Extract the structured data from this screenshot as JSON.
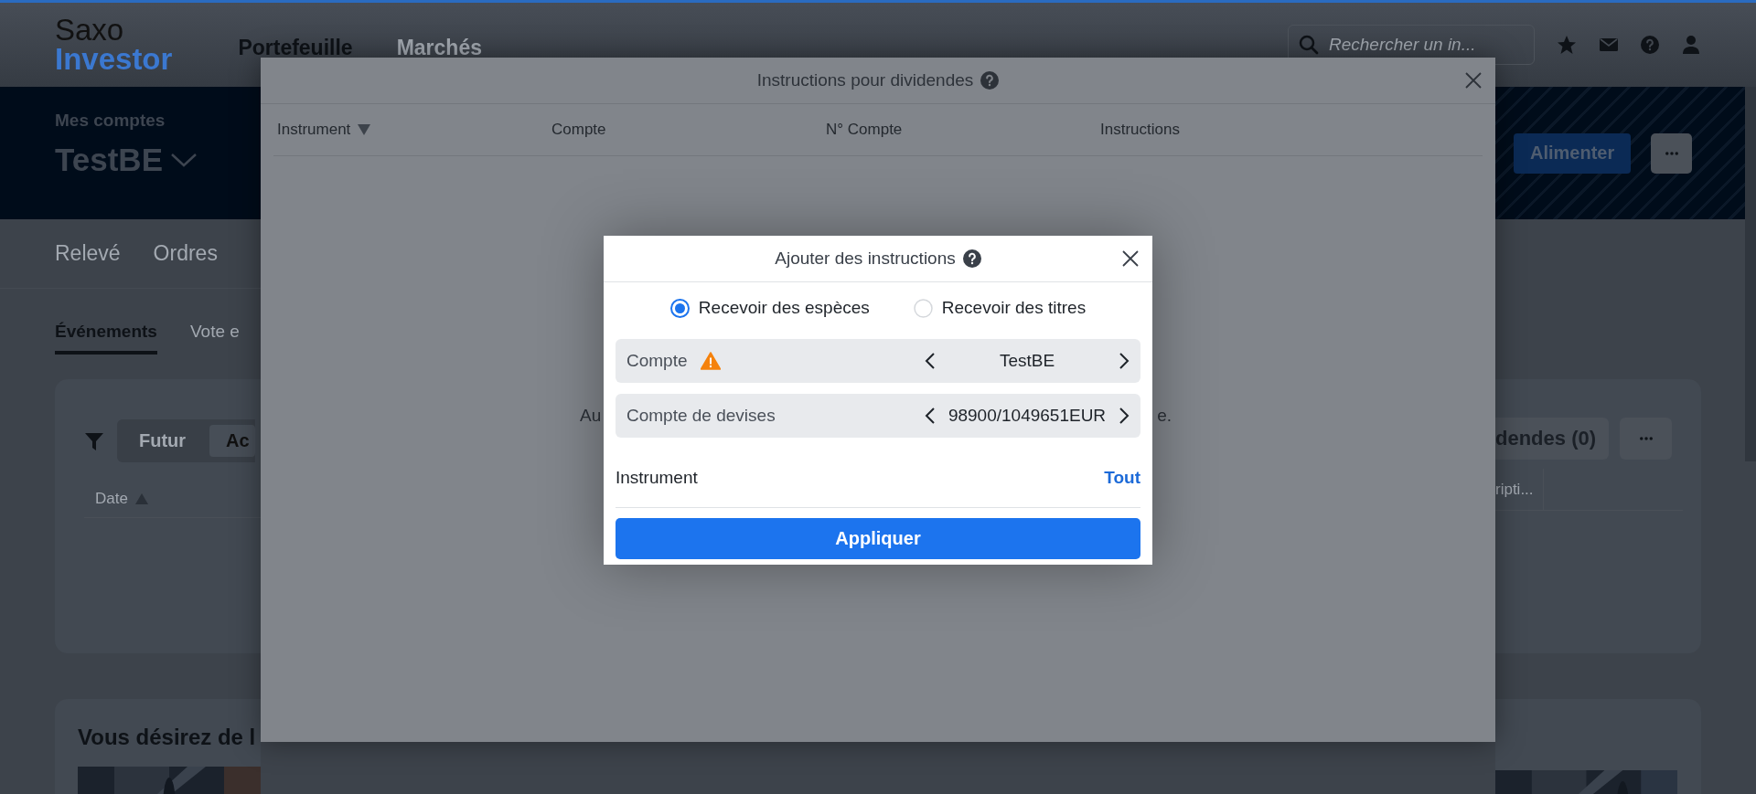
{
  "header": {
    "logo_top": "Saxo",
    "logo_bottom": "Investor",
    "nav": [
      {
        "label": "Portefeuille",
        "selected": true
      },
      {
        "label": "Marchés",
        "selected": false
      }
    ],
    "search": {
      "placeholder": "Rechercher un in..."
    }
  },
  "account": {
    "label": "Mes comptes",
    "name": "TestBE",
    "fund_button": "Alimenter"
  },
  "page_tabs": [
    {
      "label": "Relevé",
      "selected": false
    },
    {
      "label": "Ordres",
      "selected": false
    }
  ],
  "sub_tabs": [
    {
      "label": "Événements",
      "selected": true
    },
    {
      "label": "Vote e",
      "selected": false
    }
  ],
  "events_card": {
    "filters": [
      {
        "label": "Futur",
        "selected": false
      },
      {
        "label": "Ac",
        "selected": true
      }
    ],
    "dividends_button": "dendes (0)",
    "columns": [
      {
        "label": "Date",
        "sorted": true
      },
      {
        "label": "ripti...",
        "sorted": false
      }
    ]
  },
  "promo": {
    "title": "Vous désirez de l"
  },
  "dividends_modal": {
    "title": "Instructions pour dividendes",
    "columns": [
      {
        "label": "Instrument",
        "sorted": true
      },
      {
        "label": "Compte",
        "sorted": false
      },
      {
        "label": "N° Compte",
        "sorted": false
      },
      {
        "label": "Instructions",
        "sorted": false
      }
    ],
    "empty_text_start": "Au",
    "empty_text_end": "e."
  },
  "add_dialog": {
    "title": "Ajouter des instructions",
    "options": [
      {
        "label": "Recevoir des espèces",
        "selected": true
      },
      {
        "label": "Recevoir des titres",
        "selected": false
      }
    ],
    "pickers": [
      {
        "label": "Compte",
        "warning": true,
        "value": "TestBE"
      },
      {
        "label": "Compte de devises",
        "warning": false,
        "value": "98900/1049651EUR"
      }
    ],
    "instrument": {
      "label": "Instrument",
      "value": "Tout"
    },
    "apply": "Appliquer"
  }
}
